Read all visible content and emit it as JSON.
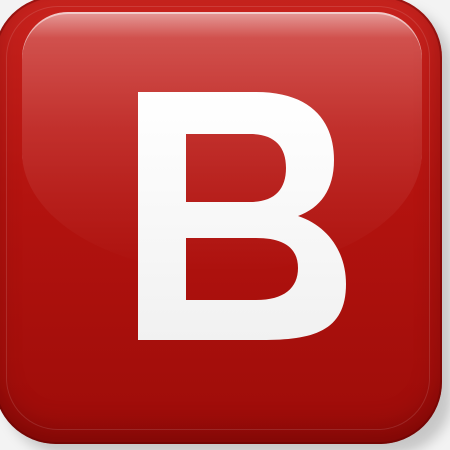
{
  "icon": {
    "letter": "B",
    "background_color": "#b3130f",
    "letter_color": "#ffffff"
  }
}
